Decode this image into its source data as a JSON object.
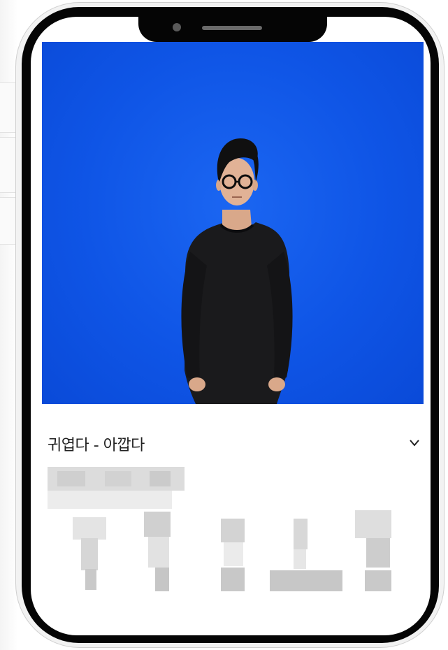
{
  "video": {
    "background_color": "#0f55e6",
    "subject": "person-signing"
  },
  "sign": {
    "title": "귀엽다 - 아깝다"
  },
  "icons": {
    "expand": "chevron-down-icon"
  },
  "colors": {
    "phone_frame": "#050505",
    "screen_bg": "#ffffff",
    "title_text": "#222222"
  }
}
